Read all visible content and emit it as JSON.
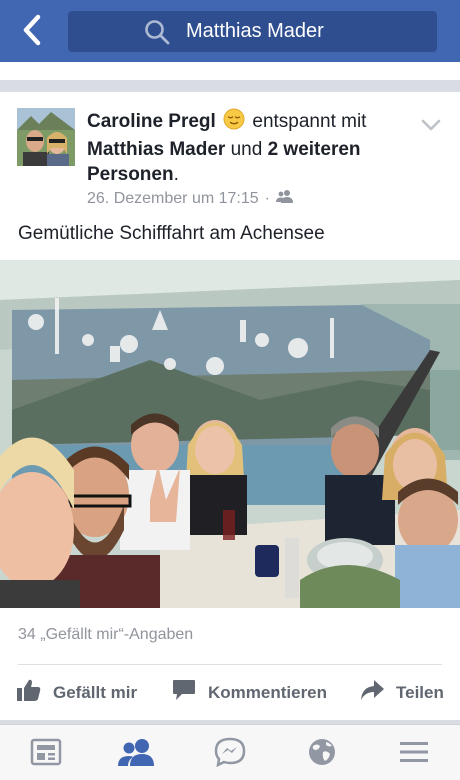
{
  "search": {
    "value": "Matthias Mader"
  },
  "post": {
    "author": "Caroline Pregl",
    "feeling_text": "entspannt mit",
    "tagged_person": "Matthias Mader",
    "connector": "und",
    "others": "2 weiteren Personen",
    "period": ".",
    "timestamp": "26. Dezember um 17:15",
    "separator": "·",
    "text": "Gemütliche Schifffahrt am Achensee",
    "likes": "34 „Gefällt mir“-Angaben"
  },
  "actions": {
    "like": "Gefällt mir",
    "comment": "Kommentieren",
    "share": "Teilen"
  },
  "colors": {
    "brand": "#4267b2",
    "search_bg": "#2f4e8f",
    "active_tab": "#4267b2",
    "inactive_tab": "#9197a3"
  },
  "icons": {
    "back": "back-arrow-icon",
    "search": "search-icon",
    "feeling": "relieved-face-icon",
    "chevron": "chevron-down-icon",
    "audience": "friends-audience-icon",
    "like": "thumbs-up-icon",
    "comment": "comment-bubble-icon",
    "share": "share-arrow-icon",
    "tab_feed": "news-feed-icon",
    "tab_friends": "friends-icon",
    "tab_messenger": "messenger-icon",
    "tab_notifications": "globe-icon",
    "tab_menu": "menu-icon"
  }
}
